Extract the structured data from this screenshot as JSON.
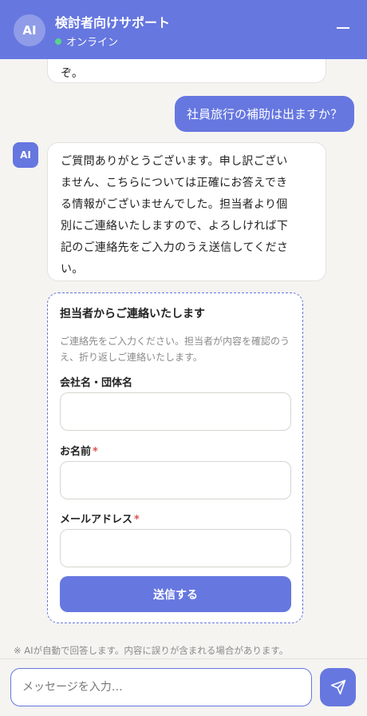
{
  "header": {
    "avatar": "AI",
    "title": "検討者向けサポート",
    "status": "オンライン",
    "status_color": "#58d38c",
    "accent_color": "#6677e0"
  },
  "messages": {
    "prev_ai_tail": "ぞ。",
    "user": "社員旅行の補助は出ますか？",
    "ai_avatar": "AI",
    "ai_lines": [
      "ご質問ありがとうございます。申し訳ござい",
      "ません、こちらについては正確にお答えでき",
      "る情報がございませんでした。担当者より個",
      "別にご連絡いたしますので、よろしければ下",
      "記のご連絡先をご入力のうえ送信してくださ",
      "い。"
    ]
  },
  "form": {
    "title": "担当者からご連絡いたします",
    "description": "ご連絡先をご入力ください。担当者が内容を確認のうえ、折り返しご連絡いたします。",
    "company_label": "会社名・団体名",
    "company_value": "",
    "name_label": "お名前",
    "email_label": "メールアドレス",
    "required_mark": "*",
    "submit_label": "送信する"
  },
  "footer": {
    "disclaimer": "※ AIが自動で回答します。内容に誤りが含まれる場合があります。",
    "composer_placeholder": "メッセージを入力…",
    "send_icon": "paper-plane-icon"
  }
}
